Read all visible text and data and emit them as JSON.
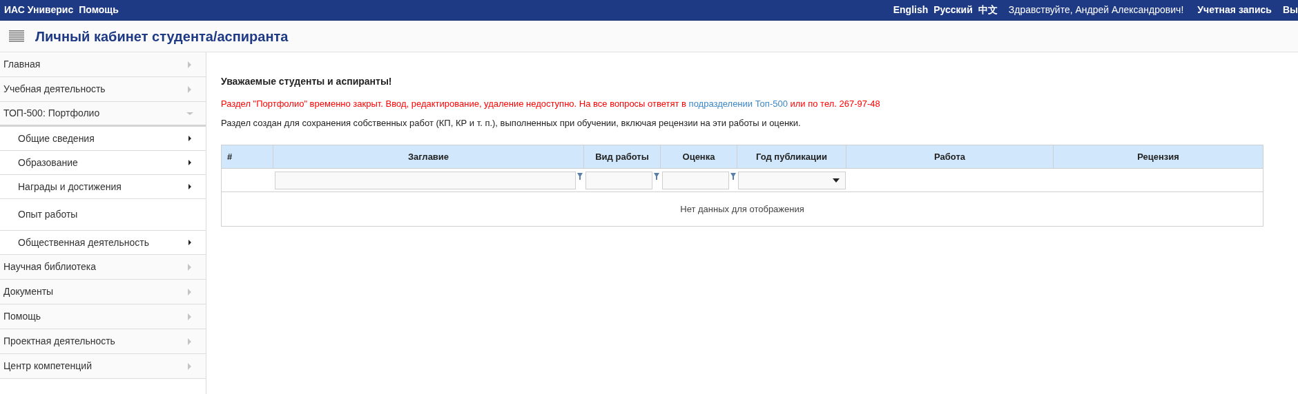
{
  "top_bar": {
    "left_links": [
      "ИАС Универис",
      "Помощь"
    ],
    "languages": [
      "English",
      "Русский",
      "中文"
    ],
    "greeting": "Здравствуйте, Андрей Александрович!",
    "account_link": "Учетная запись",
    "logout_link": "Вы"
  },
  "header": {
    "title": "Личный кабинет студента/аспиранта"
  },
  "sidebar": {
    "items": [
      {
        "label": "Главная",
        "expanded": false
      },
      {
        "label": "Учебная деятельность",
        "expanded": false
      },
      {
        "label": "ТОП-500: Портфолио",
        "expanded": true,
        "children": [
          {
            "label": "Общие сведения",
            "has_submenu": true
          },
          {
            "label": "Образование",
            "has_submenu": true
          },
          {
            "label": "Награды и достижения",
            "has_submenu": true
          },
          {
            "label": "Опыт работы",
            "has_submenu": false
          },
          {
            "label": "Общественная деятельность",
            "has_submenu": true
          }
        ]
      },
      {
        "label": "Научная библиотека",
        "expanded": false
      },
      {
        "label": "Документы",
        "expanded": false
      },
      {
        "label": "Помощь",
        "expanded": false
      },
      {
        "label": "Проектная деятельность",
        "expanded": false
      },
      {
        "label": "Центр компетенций",
        "expanded": false
      }
    ]
  },
  "content": {
    "heading": "Уважаемые студенты и аспиранты!",
    "notice": [
      {
        "text": "Раздел \"Портфолио\" временно закрыт. Ввод, редактирование, удаление недоступно. На все вопросы ответят в ",
        "link": false
      },
      {
        "text": "подразделении Топ-500",
        "link": true
      },
      {
        "text": " или по тел. 267-97-48",
        "link": false
      }
    ],
    "description": "Раздел создан для сохранения собственных работ (КП, КР и т. п.), выполненных при обучении, включая рецензии на эти работы и оценки.",
    "table": {
      "columns": [
        {
          "label": "#",
          "kind": "plain"
        },
        {
          "label": "Заглавие",
          "kind": "textfilter"
        },
        {
          "label": "Вид работы",
          "kind": "textfilter"
        },
        {
          "label": "Оценка",
          "kind": "textfilter"
        },
        {
          "label": "Год публикации",
          "kind": "selectfilter"
        },
        {
          "label": "Работа",
          "kind": "plain"
        },
        {
          "label": "Рецензия",
          "kind": "plain"
        }
      ],
      "empty_message": "Нет данных для отображения"
    }
  }
}
